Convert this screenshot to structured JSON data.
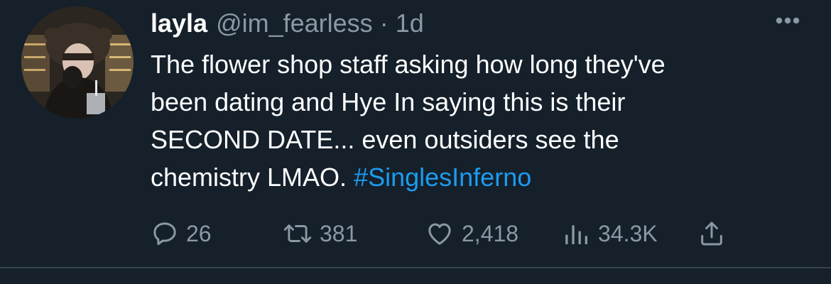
{
  "tweet": {
    "author": {
      "display_name": "layla",
      "handle": "@im_fearless",
      "separator": "·",
      "time": "1d",
      "avatar_icon": "profile-photo"
    },
    "more_icon": "more-horizontal-icon",
    "text_lines": [
      "The flower shop staff asking how long they've",
      "been dating and Hye In saying this is their",
      "SECOND DATE... even outsiders see the",
      "chemistry LMAO."
    ],
    "hashtag": "#SinglesInferno",
    "actions": {
      "reply": {
        "icon": "reply-icon",
        "count": "26"
      },
      "retweet": {
        "icon": "retweet-icon",
        "count": "381"
      },
      "like": {
        "icon": "heart-icon",
        "count": "2,418"
      },
      "views": {
        "icon": "views-icon",
        "count": "34.3K"
      },
      "share": {
        "icon": "share-icon"
      }
    }
  },
  "colors": {
    "background": "#15202b",
    "primary_text": "#ffffff",
    "secondary_text": "#8b98a5",
    "link": "#1d9bf0",
    "divider": "#38444d"
  }
}
